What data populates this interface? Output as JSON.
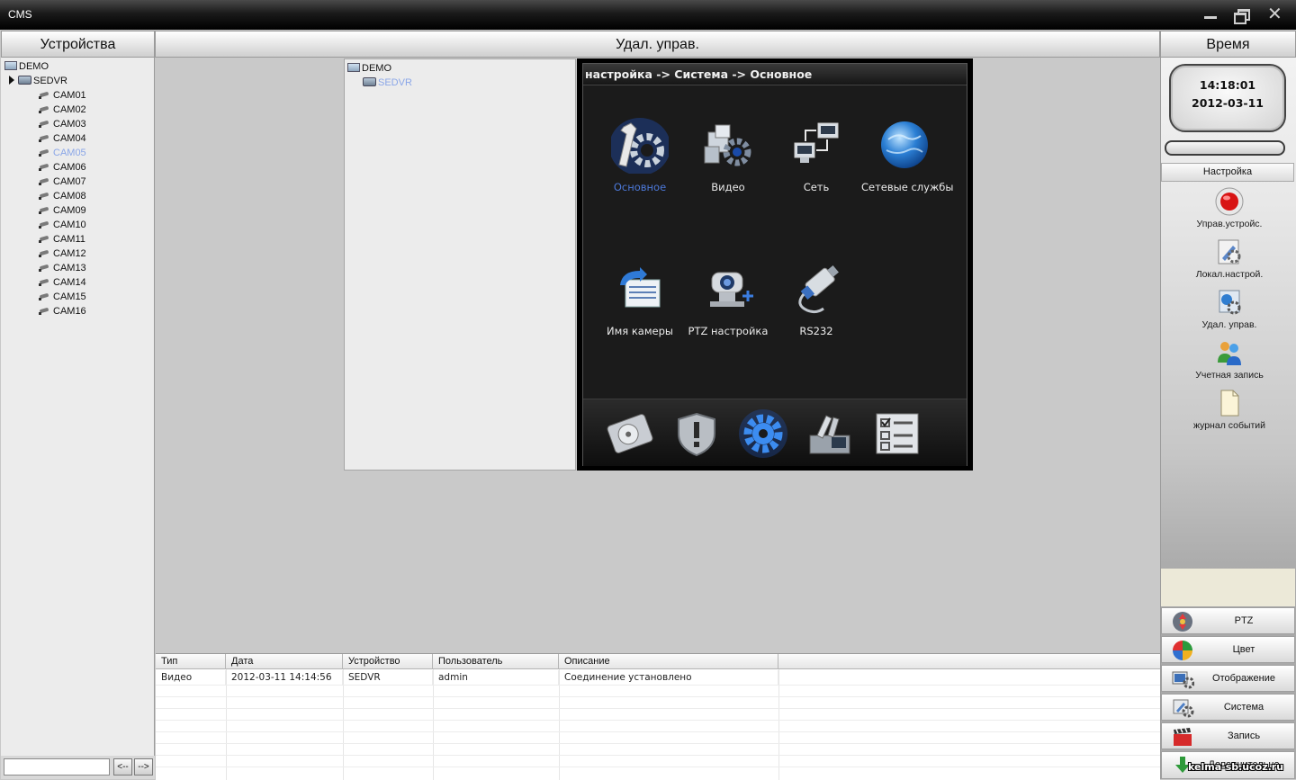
{
  "window": {
    "title": "CMS"
  },
  "headers": {
    "devices": "Устройства",
    "remote": "Удал. управ.",
    "time": "Время"
  },
  "device_tree": {
    "root": "DEMO",
    "device": "SEDVR",
    "cameras": [
      "CAM01",
      "CAM02",
      "CAM03",
      "CAM04",
      "CAM05",
      "CAM06",
      "CAM07",
      "CAM08",
      "CAM09",
      "CAM10",
      "CAM11",
      "CAM12",
      "CAM13",
      "CAM14",
      "CAM15",
      "CAM16"
    ],
    "selected_camera": "CAM05"
  },
  "left_bottom": {
    "search_value": "",
    "prev_label": "<--",
    "next_label": "-->"
  },
  "remote_tree": {
    "root": "DEMO",
    "device": "SEDVR"
  },
  "dvr_menu": {
    "breadcrumb": "настройка -> Система -> Основное",
    "items": [
      {
        "label": "Основное",
        "icon": "wrench-gear-icon",
        "active": true
      },
      {
        "label": "Видео",
        "icon": "video-gears-icon"
      },
      {
        "label": "Сеть",
        "icon": "network-icon"
      },
      {
        "label": "Сетевые службы",
        "icon": "globe-icon"
      },
      {
        "label": "Имя камеры",
        "icon": "camera-name-icon"
      },
      {
        "label": "PTZ настройка",
        "icon": "ptz-camera-icon"
      },
      {
        "label": "RS232",
        "icon": "serial-cable-icon"
      }
    ],
    "tabs": [
      "hdd-icon",
      "alarm-shield-icon",
      "gear-icon",
      "tools-icon",
      "checklist-icon"
    ],
    "active_tab": 2
  },
  "log": {
    "columns": [
      "Тип",
      "Дата",
      "Устройство",
      "Пользователь",
      "Описание"
    ],
    "rows": [
      [
        "Видео",
        "2012-03-11 14:14:56",
        "SEDVR",
        "admin",
        "Соединение установлено"
      ]
    ]
  },
  "clock": {
    "time": "14:18:01",
    "date": "2012-03-11"
  },
  "right_panel": {
    "settings_title": "Настройка",
    "items": [
      {
        "label": "Управ.устройс.",
        "icon": "record-button-icon"
      },
      {
        "label": "Локал.настрой.",
        "icon": "local-settings-icon"
      },
      {
        "label": "Удал. управ.",
        "icon": "remote-settings-icon"
      },
      {
        "label": "Учетная запись",
        "icon": "users-icon"
      },
      {
        "label": "журнал событий",
        "icon": "document-icon"
      }
    ],
    "buttons": [
      {
        "label": "PTZ",
        "icon": "ptz-icon"
      },
      {
        "label": "Цвет",
        "icon": "color-wheel-icon"
      },
      {
        "label": "Отображение",
        "icon": "display-icon"
      },
      {
        "label": "Система",
        "icon": "system-icon"
      },
      {
        "label": "Запись",
        "icon": "clapper-icon"
      },
      {
        "label": "Дополнительно",
        "icon": "download-arrow-icon"
      }
    ]
  },
  "watermark": "kelma-sb.ucoz.ru",
  "colors": {
    "selected_text": "#8aa6e8",
    "dvr_active": "#4c78d8",
    "titlebar": "#000000"
  }
}
